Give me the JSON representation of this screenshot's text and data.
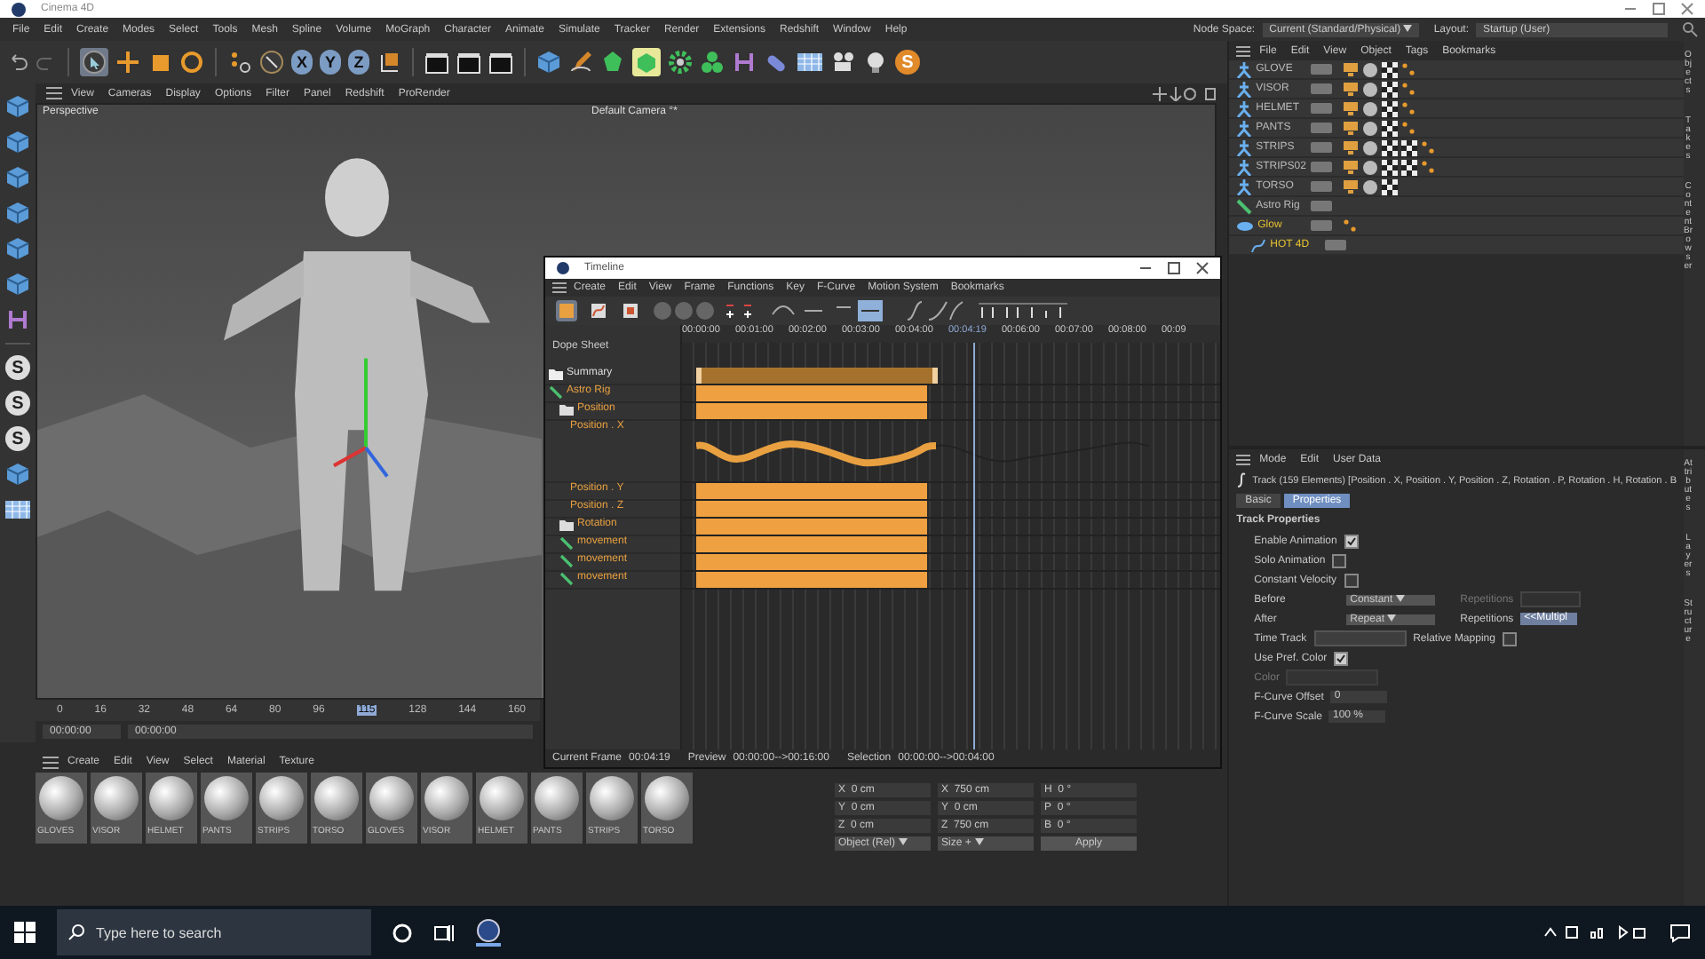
{
  "window": {
    "title": "Cinema 4D"
  },
  "menu_bar": [
    "File",
    "Edit",
    "Create",
    "Modes",
    "Select",
    "Tools",
    "Mesh",
    "Spline",
    "Volume",
    "MoGraph",
    "Character",
    "Animate",
    "Simulate",
    "Tracker",
    "Render",
    "Extensions",
    "Redshift",
    "Window",
    "Help"
  ],
  "node_space": {
    "label": "Node Space:",
    "value": "Current (Standard/Physical)"
  },
  "layout": {
    "label": "Layout:",
    "value": "Startup (User)"
  },
  "toolbar": {
    "axes": [
      {
        "label": "X",
        "on": true
      },
      {
        "label": "Y",
        "on": true
      },
      {
        "label": "Z",
        "on": true
      }
    ],
    "logo": "S"
  },
  "side_tools": {
    "badges": [
      "S",
      "S",
      "S"
    ]
  },
  "viewport": {
    "menu": [
      "View",
      "Cameras",
      "Display",
      "Options",
      "Filter",
      "Panel",
      "Redshift",
      "ProRender"
    ],
    "name": "Perspective",
    "camera": "Default Camera °*"
  },
  "ruler": {
    "ticks": [
      {
        "label": "0",
        "selected": false
      },
      {
        "label": "16",
        "selected": false
      },
      {
        "label": "32",
        "selected": false
      },
      {
        "label": "48",
        "selected": false
      },
      {
        "label": "64",
        "selected": false
      },
      {
        "label": "80",
        "selected": false
      },
      {
        "label": "96",
        "selected": false
      },
      {
        "label": "115",
        "selected": true
      },
      {
        "label": "128",
        "selected": false
      },
      {
        "label": "144",
        "selected": false
      },
      {
        "label": "160",
        "selected": false
      }
    ],
    "start": "00:00:00",
    "end": "00:00:00"
  },
  "materials": {
    "menu": [
      "Create",
      "Edit",
      "View",
      "Select",
      "Material",
      "Texture"
    ],
    "items": [
      "GLOVES",
      "VISOR",
      "HELMET",
      "PANTS",
      "STRIPS",
      "TORSO",
      "GLOVES",
      "VISOR",
      "HELMET",
      "PANTS",
      "STRIPS",
      "TORSO"
    ]
  },
  "coordinates": {
    "rows": [
      {
        "axis": "X",
        "position": "0 cm",
        "size_axis": "X",
        "size": "750 cm",
        "rotation_axis": "H",
        "rotation": "0 °"
      },
      {
        "axis": "Y",
        "position": "0 cm",
        "size_axis": "Y",
        "size": "0 cm",
        "rotation_axis": "P",
        "rotation": "0 °"
      },
      {
        "axis": "Z",
        "position": "0 cm",
        "size_axis": "Z",
        "size": "750 cm",
        "rotation_axis": "B",
        "rotation": "0 °"
      }
    ],
    "mode": "Object (Rel)",
    "size_mode": "Size +",
    "apply": "Apply"
  },
  "timeline": {
    "title": "Timeline",
    "menu": [
      "Create",
      "Edit",
      "View",
      "Frame",
      "Functions",
      "Key",
      "F-Curve",
      "Motion System",
      "Bookmarks"
    ],
    "mode": "Dope Sheet",
    "ticks": [
      "00:00:00",
      "00:01:00",
      "00:02:00",
      "00:03:00",
      "00:04:00",
      "00:04:19",
      "00:06:00",
      "00:07:00",
      "00:08:00",
      "00:09"
    ],
    "tracks": [
      {
        "name": "Summary",
        "kind": "summary",
        "selected": false
      },
      {
        "name": "Astro Rig",
        "kind": "object",
        "selected": true,
        "children": [
          {
            "name": "Position",
            "kind": "folder",
            "selected": true,
            "children": [
              {
                "name": "Position . X",
                "kind": "curve",
                "selected": true
              },
              {
                "name": "Position . Y",
                "kind": "track",
                "selected": true
              },
              {
                "name": "Position . Z",
                "kind": "track",
                "selected": true
              }
            ]
          },
          {
            "name": "Rotation",
            "kind": "folder",
            "selected": true
          },
          {
            "name": "movement",
            "kind": "object",
            "selected": true
          },
          {
            "name": "movement",
            "kind": "object",
            "selected": true
          },
          {
            "name": "movement",
            "kind": "object",
            "selected": true
          }
        ]
      }
    ],
    "status": [
      {
        "label": "Current Frame",
        "value": "00:04:19"
      },
      {
        "label": "Preview",
        "value": "00:00:00-->00:16:00"
      },
      {
        "label": "Selection",
        "value": "00:00:00-->00:04:00"
      }
    ]
  },
  "object_manager": {
    "menu": [
      "File",
      "Edit",
      "View",
      "Object",
      "Tags",
      "Bookmarks"
    ],
    "side_tabs": [
      "Objects",
      "Takes",
      "Content Browser"
    ],
    "objects": [
      {
        "name": "GLOVE",
        "kind": "mesh",
        "selected": false,
        "tags": [
          {
            "kind": "display"
          },
          {
            "kind": "material"
          },
          {
            "kind": "texture"
          },
          {
            "kind": "keys"
          }
        ]
      },
      {
        "name": "VISOR",
        "kind": "mesh",
        "selected": false,
        "tags": [
          {
            "kind": "display"
          },
          {
            "kind": "material"
          },
          {
            "kind": "texture"
          },
          {
            "kind": "keys"
          }
        ]
      },
      {
        "name": "HELMET",
        "kind": "mesh",
        "selected": false,
        "tags": [
          {
            "kind": "display"
          },
          {
            "kind": "material"
          },
          {
            "kind": "texture"
          },
          {
            "kind": "keys"
          }
        ]
      },
      {
        "name": "PANTS",
        "kind": "mesh",
        "selected": false,
        "tags": [
          {
            "kind": "display"
          },
          {
            "kind": "material"
          },
          {
            "kind": "texture"
          },
          {
            "kind": "keys"
          }
        ]
      },
      {
        "name": "STRIPS",
        "kind": "mesh",
        "selected": false,
        "tags": [
          {
            "kind": "display"
          },
          {
            "kind": "material"
          },
          {
            "kind": "texture"
          },
          {
            "kind": "texture"
          },
          {
            "kind": "keys"
          }
        ]
      },
      {
        "name": "STRIPS02",
        "kind": "mesh",
        "selected": false,
        "tags": [
          {
            "kind": "display"
          },
          {
            "kind": "material"
          },
          {
            "kind": "texture"
          },
          {
            "kind": "texture"
          },
          {
            "kind": "keys"
          }
        ]
      },
      {
        "name": "TORSO",
        "kind": "mesh",
        "selected": false,
        "tags": [
          {
            "kind": "display"
          },
          {
            "kind": "material"
          },
          {
            "kind": "texture"
          }
        ]
      },
      {
        "name": "Astro Rig",
        "kind": "rig",
        "selected": false
      },
      {
        "name": "Glow",
        "kind": "light",
        "selected": true,
        "tags": [
          {
            "kind": "keys"
          }
        ],
        "children": [
          {
            "name": "HOT 4D",
            "kind": "spline",
            "selected": true
          }
        ]
      }
    ]
  },
  "attributes": {
    "menu": [
      "Mode",
      "Edit",
      "User Data"
    ],
    "side_tabs": [
      "Attributes",
      "Layers",
      "Structure"
    ],
    "header": "Track (159 Elements) [Position . X, Position . Y, Position . Z, Rotation . P, Rotation . H, Rotation . B",
    "tabs": [
      {
        "label": "Basic",
        "selected": false
      },
      {
        "label": "Properties",
        "selected": true
      }
    ],
    "section": "Track Properties",
    "checks": [
      {
        "label": "Enable Animation",
        "checked": true
      },
      {
        "label": "Solo Animation",
        "checked": false
      },
      {
        "label": "Constant Velocity",
        "checked": false
      }
    ],
    "before": {
      "label": "Before",
      "value": "Constant"
    },
    "after": {
      "label": "After",
      "value": "Repeat"
    },
    "repetitions": [
      {
        "label": "Repetitions",
        "disabled": true
      },
      {
        "label": "Repetitions",
        "value": "<<Multipl",
        "disabled": false
      }
    ],
    "time_track": {
      "label": "Time Track"
    },
    "relative_mapping": {
      "label": "Relative Mapping",
      "checked": false
    },
    "use_pref_color": {
      "label": "Use Pref. Color",
      "checked": true
    },
    "color": {
      "label": "Color",
      "disabled": true
    },
    "offset": {
      "label": "F-Curve Offset",
      "value": "0"
    },
    "scale": {
      "label": "F-Curve Scale",
      "value": "100 %"
    }
  },
  "taskbar": {
    "search": {
      "placeholder": "Type here to search"
    }
  }
}
